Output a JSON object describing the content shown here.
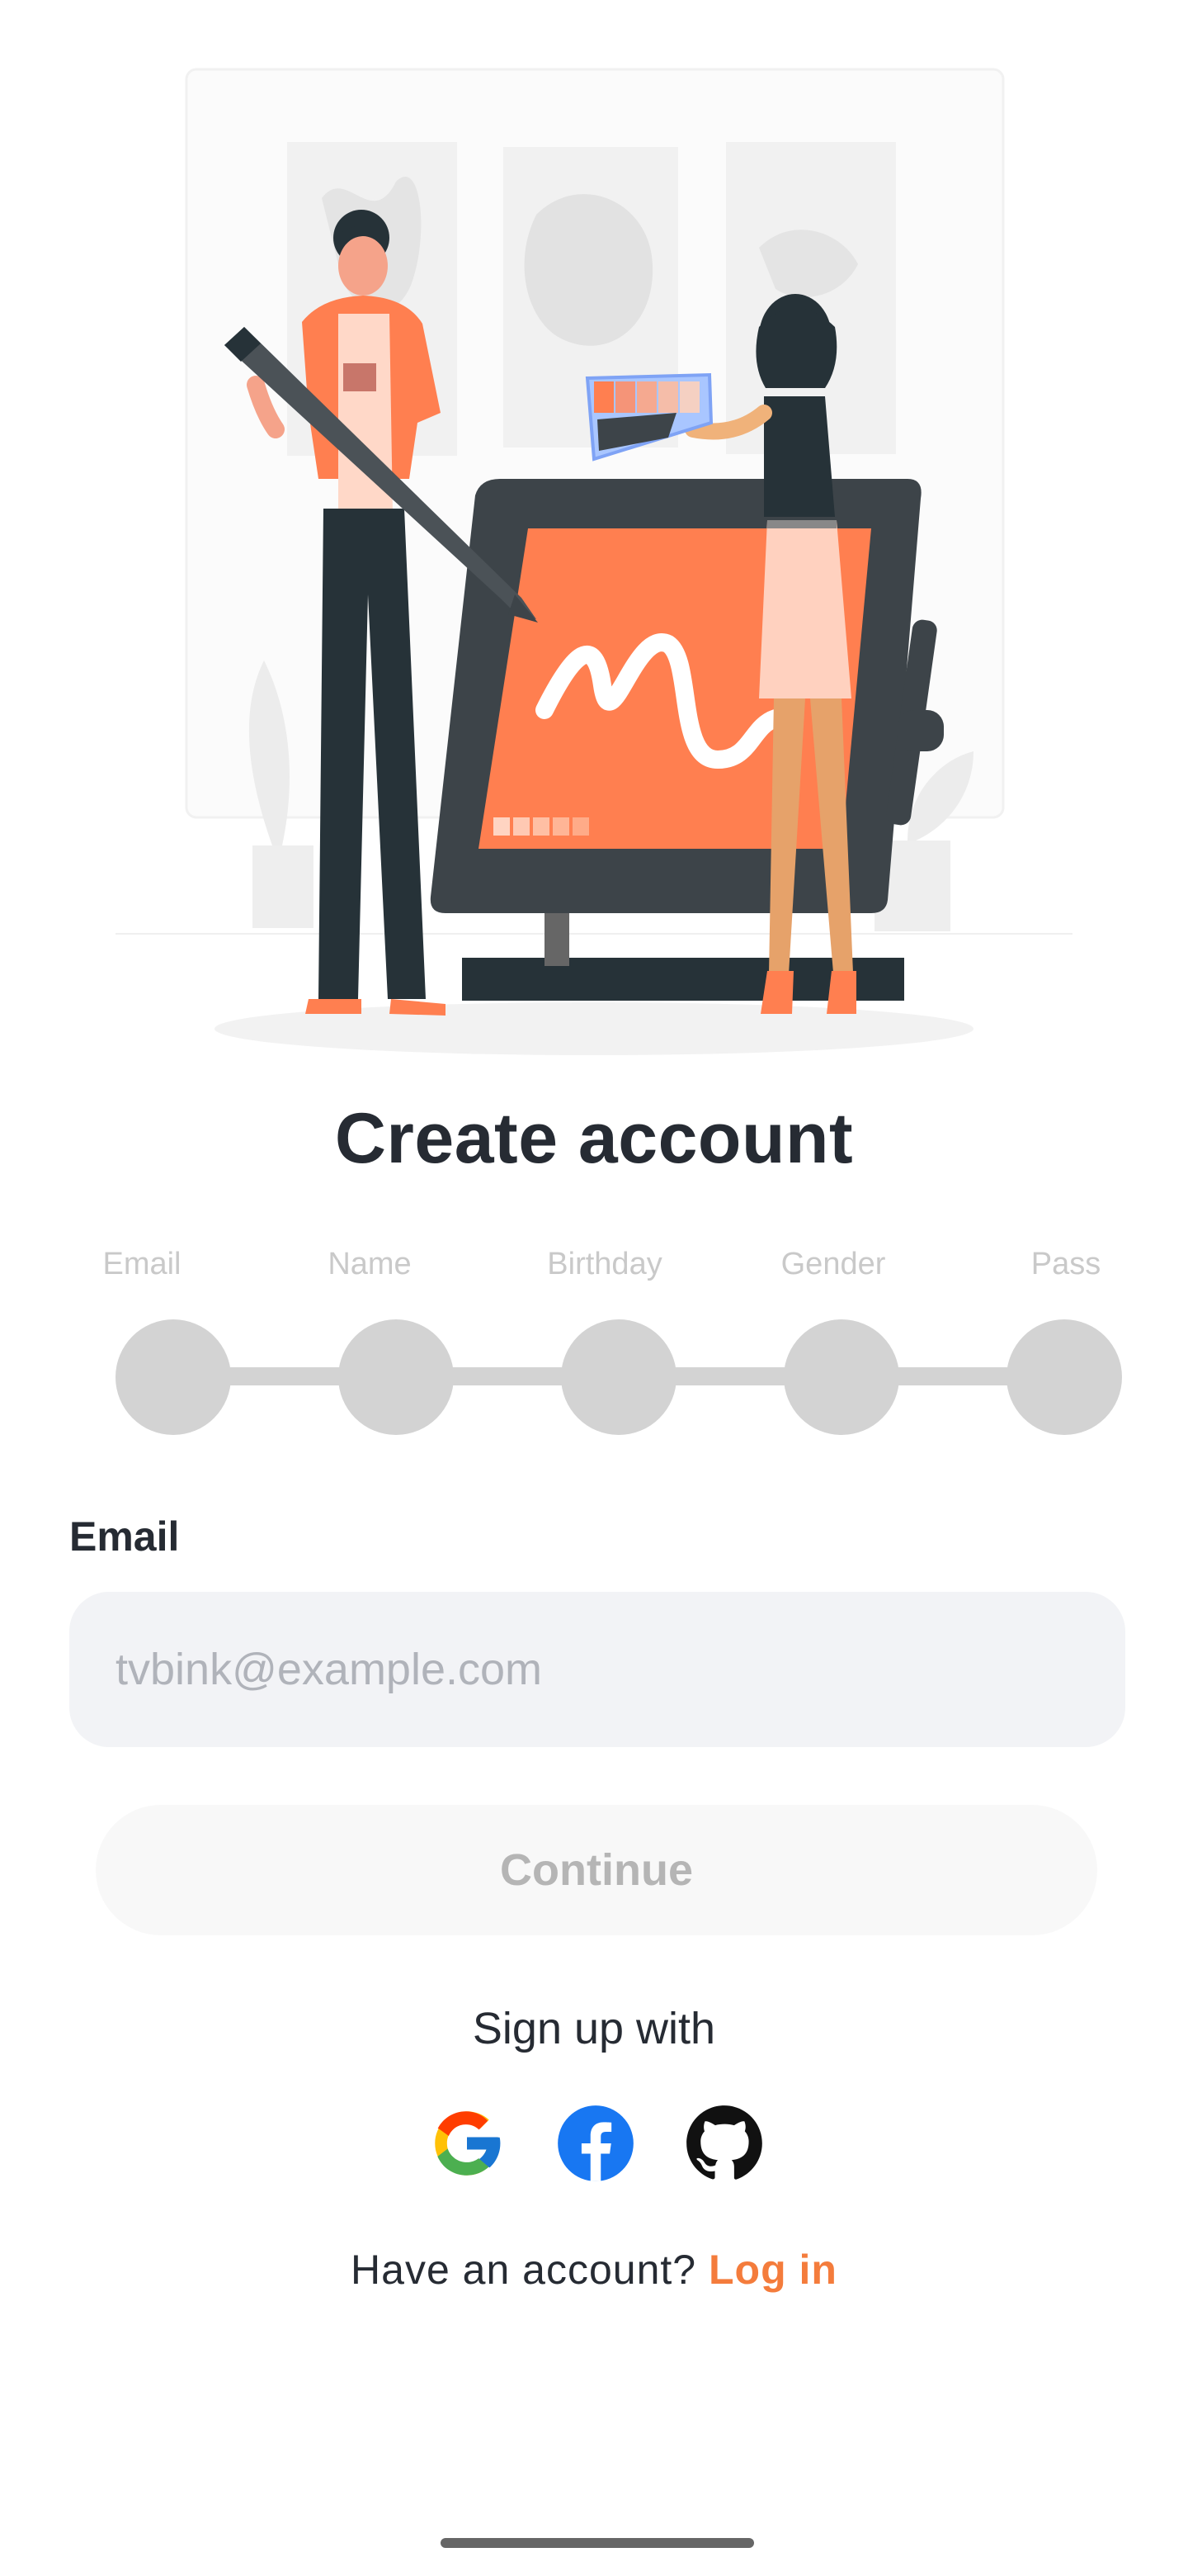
{
  "hero": {
    "illustration": "designers-with-drawing-tablet-illustration",
    "accent_color": "#FF7F50",
    "dark_color": "#263238"
  },
  "page": {
    "title": "Create account"
  },
  "steps": {
    "items": [
      {
        "label": "Email"
      },
      {
        "label": "Name"
      },
      {
        "label": "Birthday"
      },
      {
        "label": "Gender"
      },
      {
        "label": "Pass"
      }
    ],
    "current_step": 1,
    "inactive_color": "#D3D3D3"
  },
  "email_field": {
    "label": "Email",
    "value": "",
    "placeholder": "tvbink@example.com"
  },
  "continue_button": {
    "label": "Continue",
    "enabled": false
  },
  "social": {
    "heading": "Sign up with",
    "providers": [
      {
        "name": "Google",
        "icon": "google-icon"
      },
      {
        "name": "Facebook",
        "icon": "facebook-icon"
      },
      {
        "name": "GitHub",
        "icon": "github-icon"
      }
    ]
  },
  "footer": {
    "prompt": "Have an account?",
    "login_label": "Log in",
    "link_color": "#F47C3C"
  }
}
